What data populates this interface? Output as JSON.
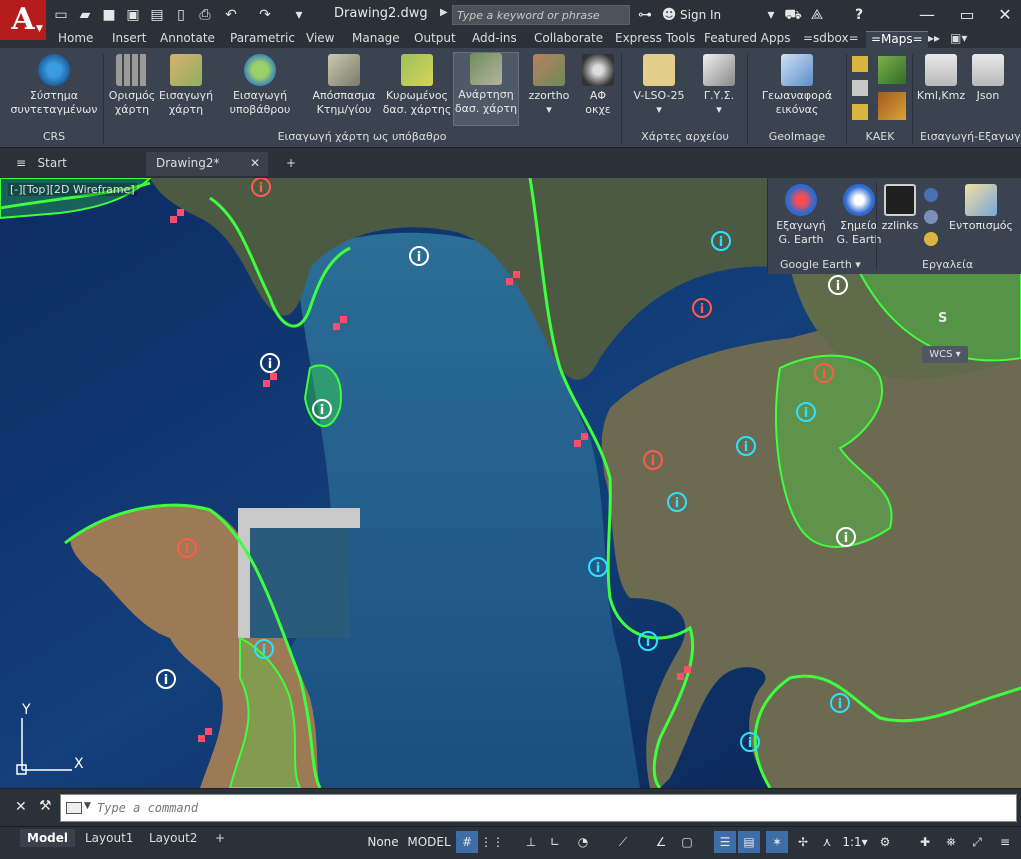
{
  "titlebar": {
    "app_logo": "A",
    "doc_title": "Drawing2.dwg",
    "search_placeholder": "Type a keyword or phrase",
    "sign_in": "Sign In",
    "help": "?"
  },
  "ribbon_tabs": [
    "Home",
    "Insert",
    "Annotate",
    "Parametric",
    "View",
    "Manage",
    "Output",
    "Add-ins",
    "Collaborate",
    "Express Tools",
    "Featured Apps",
    "=sdbox=",
    "=Maps="
  ],
  "ribbon": {
    "buttons": [
      {
        "line1": "Σύστημα",
        "line2": "συντεταγμένων"
      },
      {
        "line1": "Ορισμός",
        "line2": "χάρτη"
      },
      {
        "line1": "Εισαγωγή",
        "line2": "χάρτη"
      },
      {
        "line1": "Εισαγωγή",
        "line2": "υποβάθρου"
      },
      {
        "line1": "Απόσπασμα",
        "line2": "Κτημ/γίου"
      },
      {
        "line1": "Κυρωμένος",
        "line2": "δασ. χάρτης"
      },
      {
        "line1": "Ανάρτηση",
        "line2": "δασ. χάρτη"
      },
      {
        "line1": "zzortho",
        "line2": ""
      },
      {
        "line1": "ΑΦ",
        "line2": "οκχε"
      },
      {
        "line1": "V-LSO-25",
        "line2": ""
      },
      {
        "line1": "Γ.Υ.Σ.",
        "line2": ""
      },
      {
        "line1": "Γεωαναφορά",
        "line2": "εικόνας"
      },
      {
        "line1": "Kml,Kmz",
        "line2": ""
      },
      {
        "line1": "Json",
        "line2": ""
      }
    ],
    "groups": [
      "CRS",
      "Εισαγωγή χάρτη ως υπόβαθρο",
      "Χάρτες αρχείου",
      "GeoImage",
      "ΚΑΕΚ",
      "Εισαγωγή-Εξαγωγ"
    ]
  },
  "doc_tabs": {
    "start": "Start",
    "drawing": "Drawing2*",
    "add": "+"
  },
  "viewport": {
    "label": "[-][Top][2D Wireframe]",
    "wcs": "WCS",
    "compass_s": "S",
    "ucs_x": "X",
    "ucs_y": "Y"
  },
  "ge_panel": {
    "buttons": [
      {
        "line1": "Εξαγωγή",
        "line2": "G. Earth"
      },
      {
        "line1": "Σημεία",
        "line2": "G. Earth"
      },
      {
        "line1": "zzlinks",
        "line2": ""
      },
      {
        "line1": "Εντοπισμός",
        "line2": ""
      }
    ],
    "groups": [
      "Google Earth",
      "Εργαλεία"
    ]
  },
  "command": {
    "placeholder": "Type a command"
  },
  "status": {
    "layouts": [
      "Model",
      "Layout1",
      "Layout2",
      "+"
    ],
    "none": "None",
    "model": "MODEL",
    "scale": "1:1"
  },
  "colors": {
    "map_boundary": "#3dff3d",
    "info_cyan": "#2ee0ff",
    "info_red": "#ff5a4a",
    "pink_marker": "#ff4d6b"
  }
}
